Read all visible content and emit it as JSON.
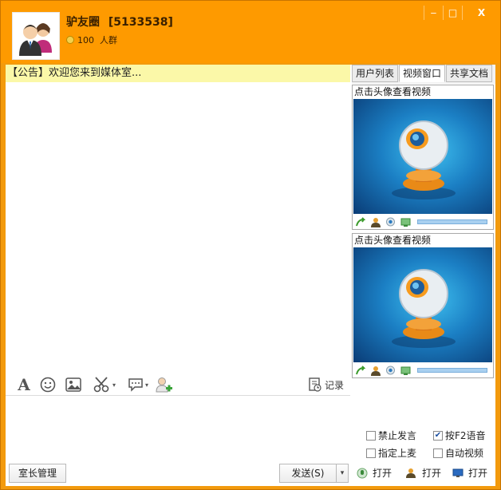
{
  "title": {
    "room_name": "驴友圈",
    "room_id": "[5133538]",
    "member_count": "100",
    "member_unit": "人群",
    "buttons": {
      "minimize": "‒",
      "maximize": "□",
      "close": "X"
    }
  },
  "notice": "【公告】欢迎您来到媒体室...",
  "tabs": [
    {
      "label": "用户列表",
      "active": false
    },
    {
      "label": "视频窗口",
      "active": true
    },
    {
      "label": "共享文档",
      "active": false
    }
  ],
  "videos": [
    {
      "title": "点击头像查看视频"
    },
    {
      "title": "点击头像查看视频"
    }
  ],
  "toolbar": {
    "record_label": "记录",
    "icons": [
      "font-icon",
      "emoji-icon",
      "image-icon",
      "scissors-icon",
      "chat-bubble-icon",
      "add-user-icon"
    ]
  },
  "checkboxes": [
    {
      "label": "禁止发言",
      "checked": false
    },
    {
      "label": "按F2语音",
      "checked": true
    },
    {
      "label": "指定上麦",
      "checked": false
    },
    {
      "label": "自动视频",
      "checked": false
    }
  ],
  "bottom": {
    "manage_label": "室长管理",
    "send_label": "发送(S)",
    "send_arrow": "▾",
    "open1": "打开",
    "open2": "打开",
    "open3": "打开"
  }
}
